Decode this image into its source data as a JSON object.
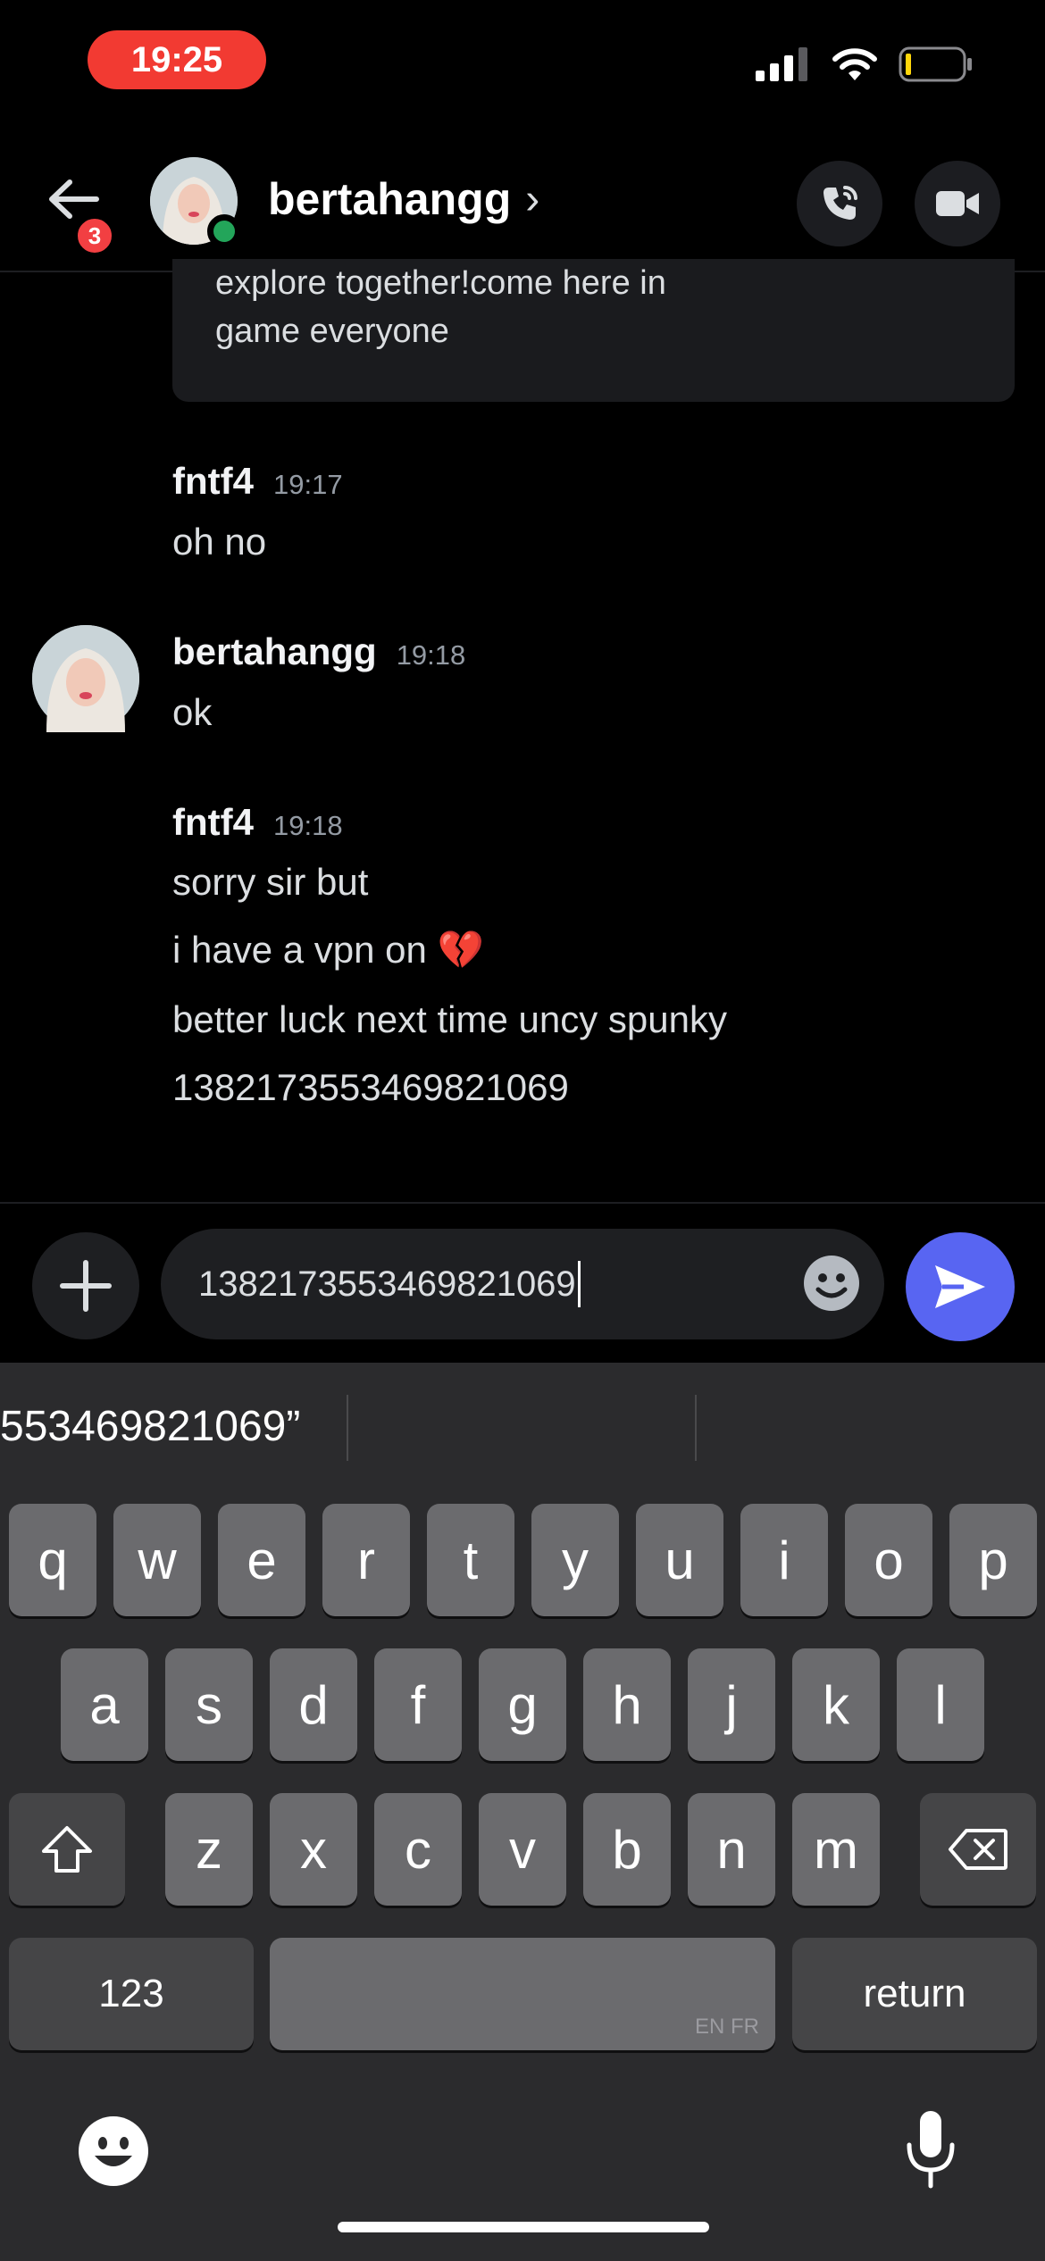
{
  "status_bar": {
    "time": "19:25"
  },
  "header": {
    "back_badge": "3",
    "username": "bertahangg",
    "chevron": "›"
  },
  "messages": {
    "embed_lines": [
      "explore together!come here in",
      "game everyone"
    ],
    "groups": [
      {
        "author": "fntf4",
        "time": "19:17",
        "lines": [
          "oh no"
        ]
      },
      {
        "author": "bertahangg",
        "time": "19:18",
        "lines": [
          "ok"
        ]
      },
      {
        "author": "fntf4",
        "time": "19:18",
        "lines": [
          "sorry sir but",
          "i have a vpn on 💔",
          "better luck next time uncy spunky",
          "1382173553469821069"
        ]
      }
    ]
  },
  "composer": {
    "input_value": "1382173553469821069"
  },
  "keyboard": {
    "suggestion": "553469821069”",
    "row1": [
      "q",
      "w",
      "e",
      "r",
      "t",
      "y",
      "u",
      "i",
      "o",
      "p"
    ],
    "row2": [
      "a",
      "s",
      "d",
      "f",
      "g",
      "h",
      "j",
      "k",
      "l"
    ],
    "row3": [
      "z",
      "x",
      "c",
      "v",
      "b",
      "n",
      "m"
    ],
    "numbers_label": "123",
    "language_label": "EN FR",
    "return_label": "return"
  },
  "colors": {
    "background": "#000000",
    "accent": "#5865f2",
    "badge": "#f23f42",
    "online": "#23a55a",
    "status_pill": "#f23a32"
  }
}
